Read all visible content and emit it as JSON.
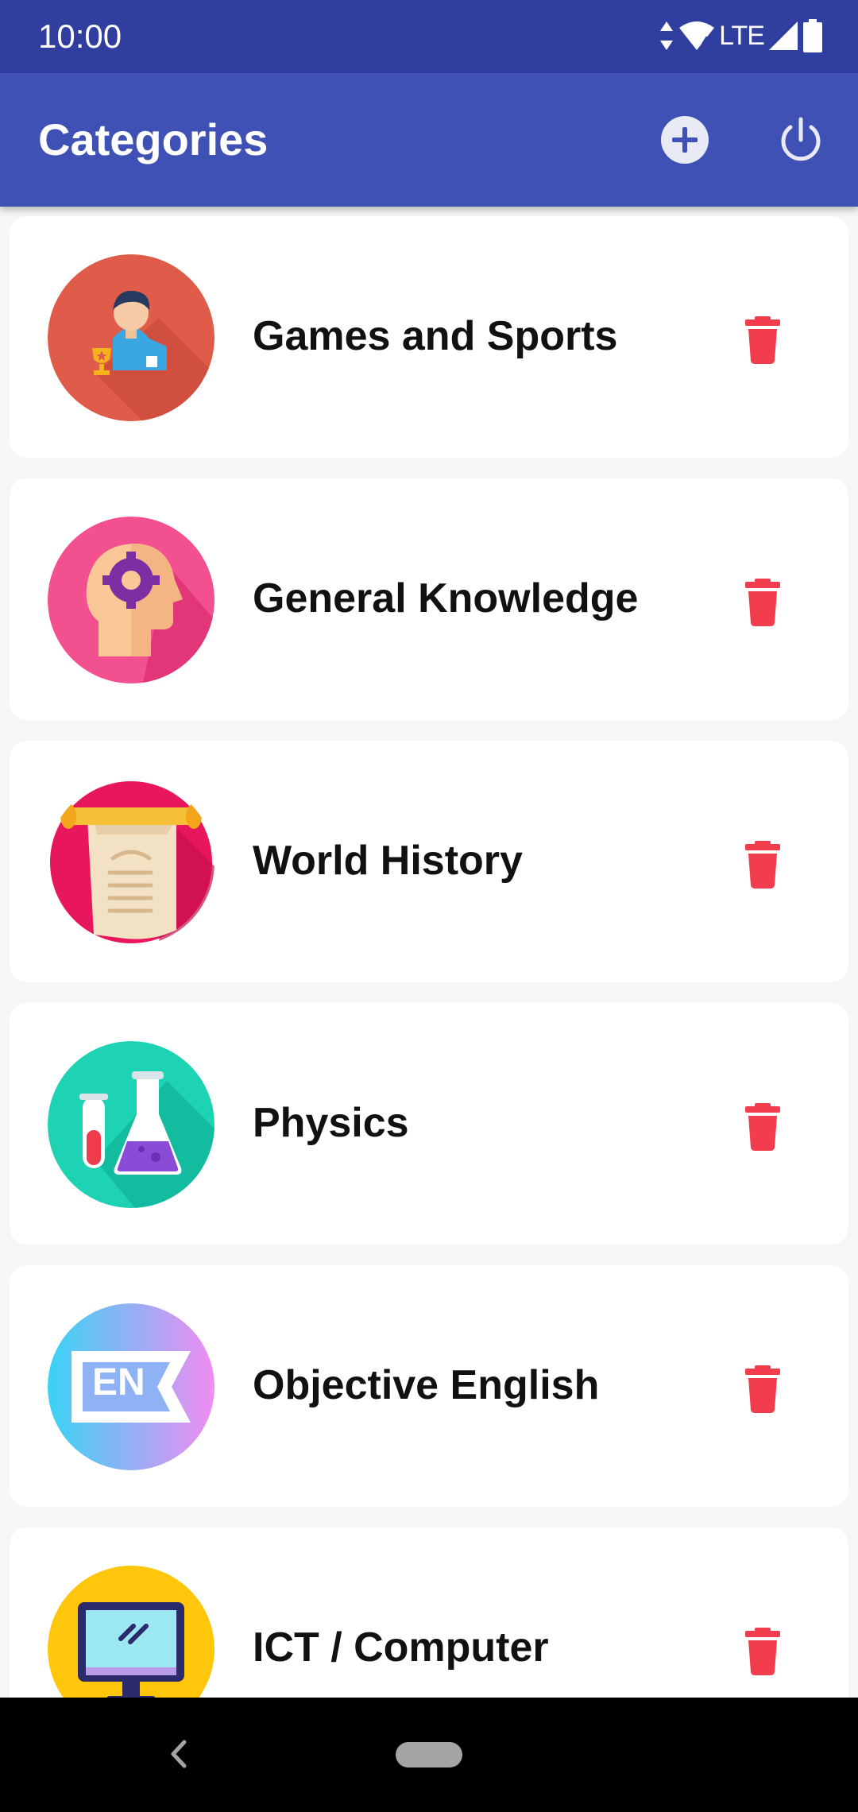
{
  "status_bar": {
    "time": "10:00",
    "network": "LTE",
    "icons": [
      "data-arrows-icon",
      "wifi-icon",
      "signal-icon",
      "battery-icon"
    ]
  },
  "app_bar": {
    "title": "Categories",
    "actions": [
      "add-icon",
      "power-icon"
    ]
  },
  "categories": [
    {
      "name": "Games and Sports",
      "icon": "games-sports-icon",
      "color": "#e05c4a"
    },
    {
      "name": "General Knowledge",
      "icon": "brain-gear-icon",
      "color": "#f2508e"
    },
    {
      "name": "World History",
      "icon": "scroll-icon",
      "color": "#e8175d"
    },
    {
      "name": "Physics",
      "icon": "lab-flask-icon",
      "color": "#1ed2b4"
    },
    {
      "name": "Objective English",
      "icon": "english-flag-icon",
      "color": "#9aa3f6"
    },
    {
      "name": "ICT / Computer",
      "icon": "computer-monitor-icon",
      "color": "#ffc60b"
    }
  ],
  "colors": {
    "status_bar": "#303f9f",
    "app_bar": "#3f51b5",
    "delete": "#f23d4f",
    "background": "#f6f6f6"
  },
  "nav_bar": {
    "icons": [
      "back-icon",
      "home-pill-icon"
    ]
  }
}
